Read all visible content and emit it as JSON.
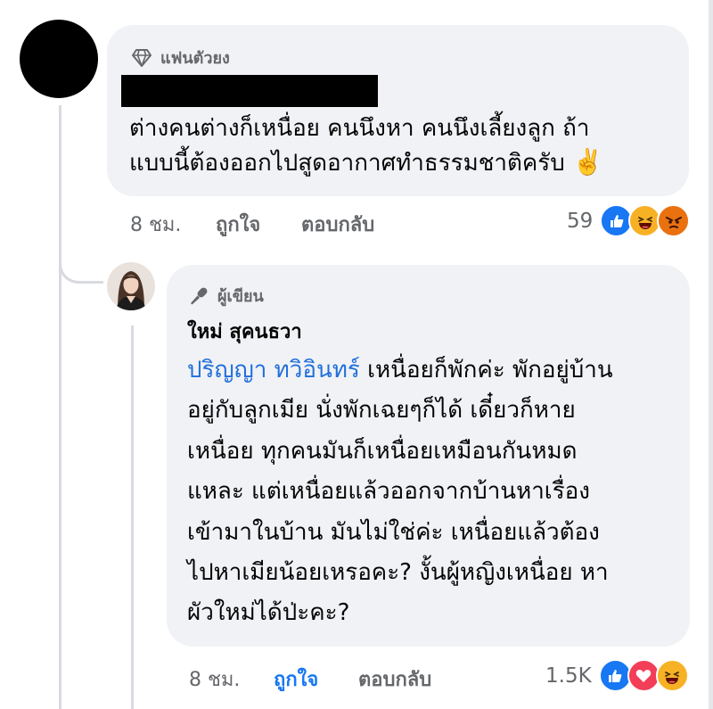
{
  "comment1": {
    "badge": "แฟนตัวยง",
    "badge_icon": "diamond-icon",
    "text": "ต่างคนต่างก็เหนื่อย คนนึงหา คนนึงเลี้ยงลูก ถ้า\nแบบนี้ต้องออกไปสูดอากาศทำธรรมชาติครับ",
    "emoji": "✌️",
    "time": "8 ชม.",
    "like_label": "ถูกใจ",
    "reply_label": "ตอบกลับ",
    "reaction_count": "59",
    "reactions": [
      "like",
      "haha",
      "angry"
    ]
  },
  "reply": {
    "badge": "ผู้เขียน",
    "badge_icon": "microphone-icon",
    "author": "ใหม่ สุคนธวา",
    "mention": "ปริญญา ทวิอินทร์",
    "text_first": " เหนื่อยก็พักค่ะ พักอยู่บ้าน",
    "text_rest": "อยู่กับลูกเมีย นั่งพักเฉยๆก็ได้ เดี๋ยวก็หาย\nเหนื่อย ทุกคนมันก็เหนื่อยเหมือนกันหมด\nแหละ แต่เหนื่อยแล้วออกจากบ้านหาเรื่อง\nเข้ามาในบ้าน มันไม่ใช่ค่ะ เหนื่อยแล้วต้อง\nไปหาเมียน้อยเหรอคะ? งั้นผู้หญิงเหนื่อย หา\nผัวใหม่ได้ป่ะคะ?",
    "time": "8 ชม.",
    "like_label": "ถูกใจ",
    "reply_label": "ตอบกลับ",
    "reaction_count": "1.5K",
    "reactions": [
      "like",
      "love",
      "haha"
    ]
  },
  "colors": {
    "bubble": "#f0f2f5",
    "link_blue": "#216fdb",
    "like_blue": "#1877f2",
    "secondary_text": "#65676b"
  }
}
